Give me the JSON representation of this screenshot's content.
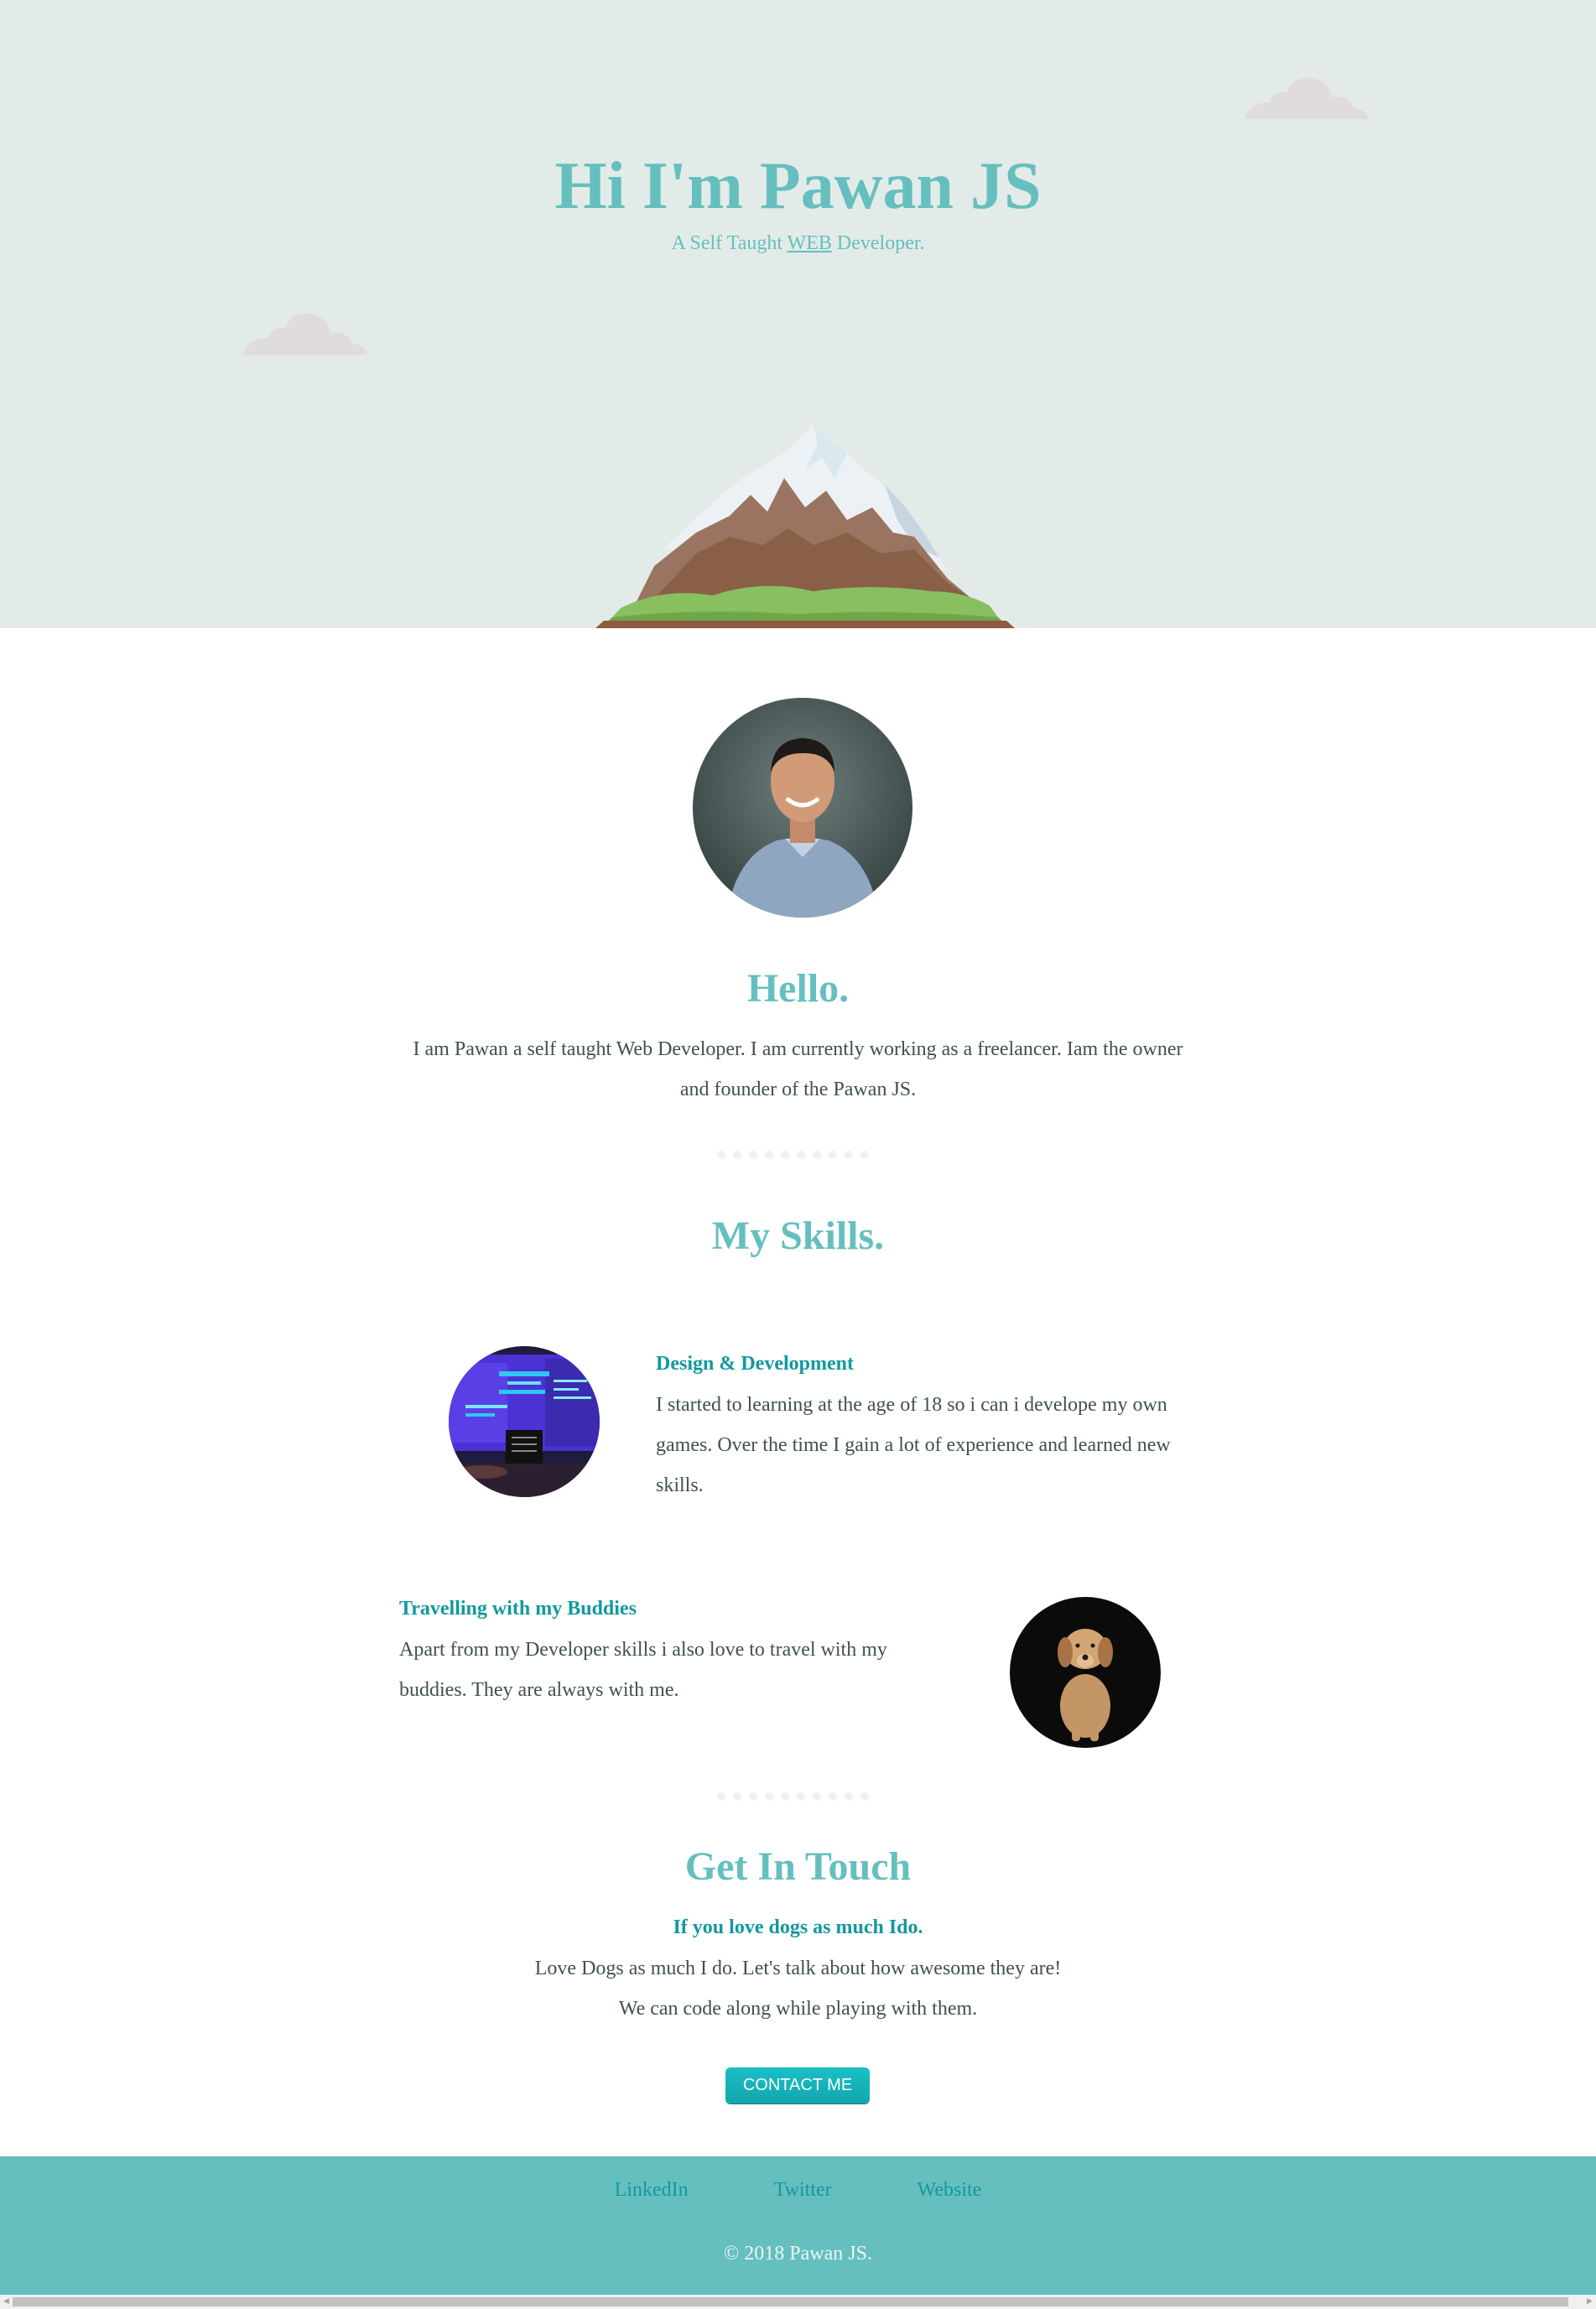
{
  "hero": {
    "title": "Hi I'm Pawan JS",
    "subtitle_before": "A Self Taught ",
    "subtitle_highlight": "WEB",
    "subtitle_after": " Developer."
  },
  "about": {
    "heading": "Hello.",
    "text": "I am Pawan a self taught Web Developer. I am currently working as a freelancer. Iam the owner and founder of the Pawan JS."
  },
  "skills": {
    "heading": "My Skills.",
    "items": [
      {
        "title": "Design & Development",
        "text": "I started to learning at the age of 18 so i can i develope my own games. Over the time I gain a lot of experience and learned new skills."
      },
      {
        "title": "Travelling with my Buddies",
        "text": "Apart from my Developer skills i also love to travel with my buddies. They are always with me."
      }
    ]
  },
  "contact": {
    "heading": "Get In Touch",
    "subheading": "If you love dogs as much Ido.",
    "line1": "Love Dogs as much I do. Let's talk about how awesome they are!",
    "line2": "We can code along while playing with them.",
    "button_label": "CONTACT ME"
  },
  "footer": {
    "links": [
      "LinkedIn",
      "Twitter",
      "Website"
    ],
    "copyright": "© 2018 Pawan JS."
  },
  "colors": {
    "primary": "#66bfbf",
    "accent": "#11999e",
    "hero_bg": "#e2ebe7",
    "text": "#40514e"
  }
}
